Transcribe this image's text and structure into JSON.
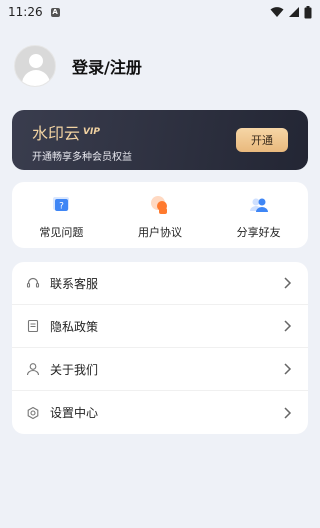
{
  "status_bar": {
    "time": "11:26",
    "notification_badge": "A"
  },
  "profile": {
    "login_label": "登录/注册"
  },
  "vip": {
    "title": "水印云",
    "tag": "VIP",
    "subtitle": "开通畅享多种会员权益",
    "button_label": "开通"
  },
  "quick": [
    {
      "label": "常见问题",
      "icon": "faq-icon"
    },
    {
      "label": "用户协议",
      "icon": "agreement-icon"
    },
    {
      "label": "分享好友",
      "icon": "share-friends-icon"
    }
  ],
  "menu": [
    {
      "label": "联系客服",
      "icon": "headset-icon"
    },
    {
      "label": "隐私政策",
      "icon": "document-icon"
    },
    {
      "label": "关于我们",
      "icon": "user-icon"
    },
    {
      "label": "设置中心",
      "icon": "settings-gear-icon"
    }
  ],
  "colors": {
    "accent_gold": "#f2d3a2",
    "card_dark": "#2a2d3b",
    "background": "#eef1f7"
  }
}
